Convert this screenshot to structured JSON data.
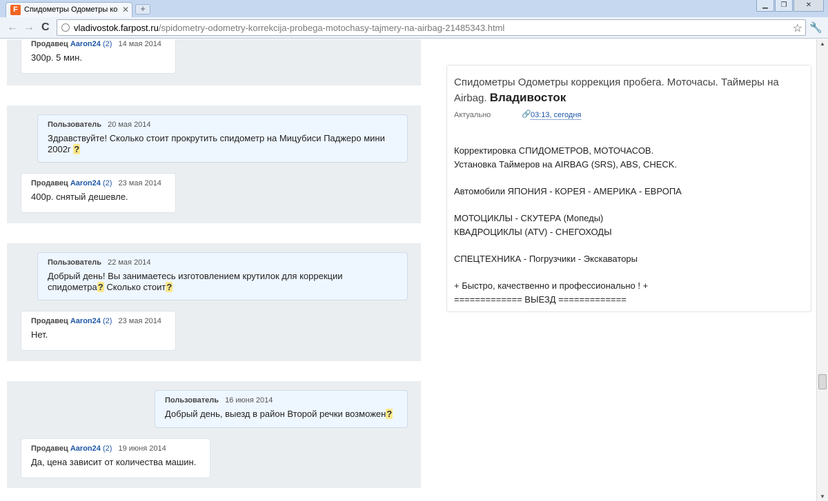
{
  "browser": {
    "tab_title": "Спидометры Одометры корр",
    "tab_favicon": "F",
    "tab_close": "✕",
    "new_tab": "+",
    "win_min": "▁",
    "win_max": "❐",
    "win_close": "✕",
    "back": "←",
    "forward": "→",
    "reload": "C",
    "url_host": "vladivostok.farpost.ru",
    "url_path": "/spidometry-odometry-korrekcija-probega-motochasy-tajmery-na-airbag-21485343.html",
    "star": "☆",
    "wrench": "🔧"
  },
  "threads": [
    {
      "seller": {
        "role": "Продавец",
        "nick": "Aaron24",
        "count": "(2)",
        "date": "14 мая 2014",
        "text": "300р. 5 мин."
      }
    },
    {
      "user": {
        "role": "Пользователь",
        "date": "20 мая 2014",
        "text": "Здравствуйте! Сколько стоит прокрутить спидометр на Мицубиси Паджеро мини 2002г",
        "q": "?"
      },
      "seller": {
        "role": "Продавец",
        "nick": "Aaron24",
        "count": "(2)",
        "date": "23 мая 2014",
        "text": "400р. снятый дешевле."
      }
    },
    {
      "user": {
        "role": "Пользователь",
        "date": "22 мая 2014",
        "text_a": "Добрый день! Вы занимаетесь изготовлением крутилок для коррекции спидометра",
        "q1": "?",
        "text_b": " Сколько стоит",
        "q2": "?"
      },
      "seller": {
        "role": "Продавец",
        "nick": "Aaron24",
        "count": "(2)",
        "date": "23 мая 2014",
        "text": "Нет."
      }
    },
    {
      "user": {
        "role": "Пользователь",
        "date": "16 июня 2014",
        "text": "Добрый день, выезд в район Второй речки возможен",
        "q": "?"
      },
      "seller": {
        "role": "Продавец",
        "nick": "Aaron24",
        "count": "(2)",
        "date": "19 июня 2014",
        "text": "Да, цена зависит от количества машин."
      }
    }
  ],
  "listing": {
    "title": "Спидометры Одометры коррекция пробега. Моточасы. Таймеры на Airbag.",
    "city": "Владивосток",
    "actual_label": "Актуально",
    "actual_time": "03:13, сегодня",
    "description": "Корректировка СПИДОМЕТРОВ, МОТОЧАСОВ.\nУстановка Таймеров на AIRBAG (SRS), ABS, CHECK.\n\nАвтомобили ЯПОНИЯ - КОРЕЯ - АМЕРИКА - ЕВРОПА\n\nМОТОЦИКЛЫ - СКУТЕРА (Мопеды)\nКВАДРОЦИКЛЫ (ATV) - СНЕГОХОДЫ\n\nСПЕЦТЕХНИКА - Погрузчики - Экскаваторы\n\n+ Быстро, качественно и профессионально ! +\n============= ВЫЕЗД ============="
  }
}
